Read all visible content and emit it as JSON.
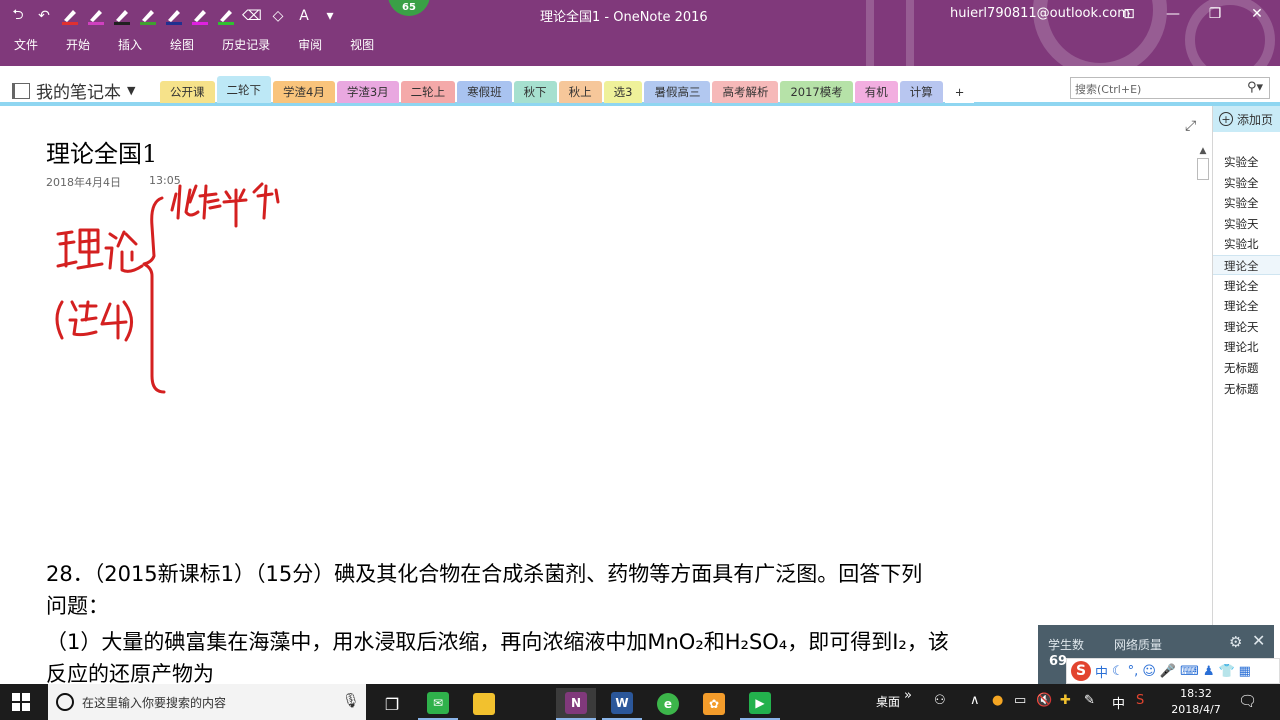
{
  "titlebar": {
    "window_title": "理论全国1 - OneNote 2016",
    "account": "huierl790811@outlook.com",
    "badge": "65",
    "menu": [
      "文件",
      "开始",
      "插入",
      "绘图",
      "历史记录",
      "审阅",
      "视图"
    ],
    "pen_colors": [
      "#e03030",
      "#d040c0",
      "#202020",
      "#40a030",
      "#203090",
      "#e020e0",
      "#30c030"
    ]
  },
  "notebook": {
    "name": "我的笔记本",
    "tabs": [
      {
        "label": "公开课",
        "color": "#f6e28a"
      },
      {
        "label": "二轮下",
        "color": "#bde8f6",
        "active": true
      },
      {
        "label": "学渣4月",
        "color": "#f9c47c"
      },
      {
        "label": "学渣3月",
        "color": "#e9a8e0"
      },
      {
        "label": "二轮上",
        "color": "#f4a9a9"
      },
      {
        "label": "寒假班",
        "color": "#a9c3f0"
      },
      {
        "label": "秋下",
        "color": "#a6e0cf"
      },
      {
        "label": "秋上",
        "color": "#f6c79a"
      },
      {
        "label": "选3",
        "color": "#eff19a"
      },
      {
        "label": "暑假高三",
        "color": "#b2c8f0"
      },
      {
        "label": "高考解析",
        "color": "#f6b9b9"
      },
      {
        "label": "2017模考",
        "color": "#b6e2a8"
      },
      {
        "label": "有机",
        "color": "#f2aee0"
      },
      {
        "label": "计算",
        "color": "#b8c6f0"
      },
      {
        "label": "+",
        "color": "#ffffff"
      }
    ],
    "search_placeholder": "搜索(Ctrl+E)"
  },
  "page": {
    "title": "理论全国1",
    "date": "2018年4月4日",
    "time": "13:05",
    "question_lines": [
      "28．（2015新课标1）（15分）碘及其化合物在合成杀菌剂、药物等方面具有广泛图。回答下列",
      "问题：",
      "（1）大量的碘富集在海藻中，用水浸取后浓缩，再向浓缩液中加MnO₂和H₂SO₄，即可得到I₂，该",
      "反应的还原产物为"
    ]
  },
  "page_list": {
    "add_label": "添加页",
    "items": [
      "实验全",
      "实验全",
      "实验全",
      "实验天",
      "实验北",
      "理论全",
      "理论全",
      "理论全",
      "理论天",
      "理论北",
      "无标题",
      "无标题"
    ],
    "selected_index": 5
  },
  "overlay": {
    "label1": "学生数",
    "label2": "网络质量",
    "value1": "69"
  },
  "ime": {
    "lang": "中"
  },
  "taskbar": {
    "search_placeholder": "在这里输入你要搜索的内容",
    "desktop": "桌面",
    "ime_lang": "中",
    "time": "18:32",
    "date": "2018/4/7"
  }
}
